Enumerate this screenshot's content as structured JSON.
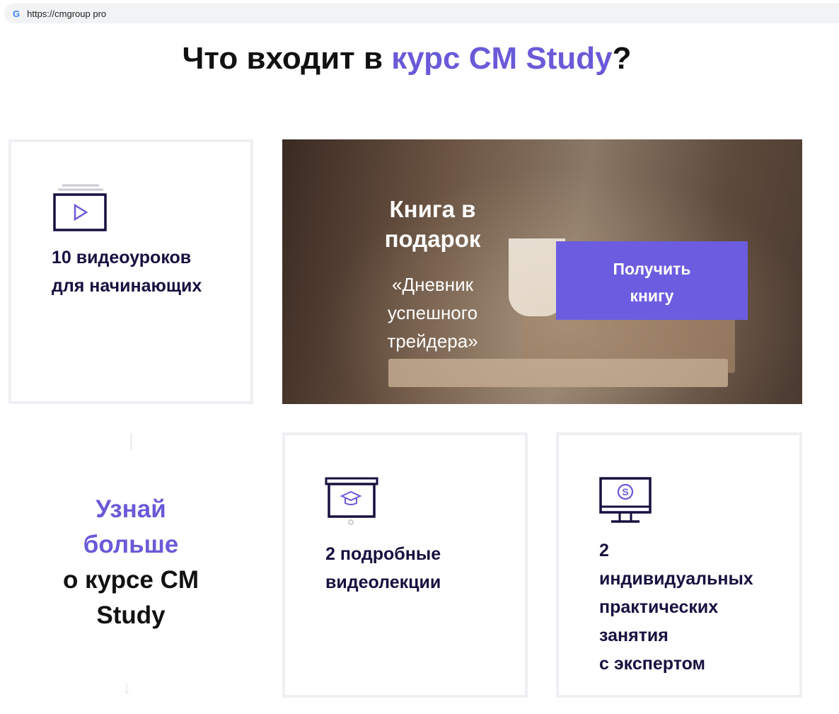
{
  "browser": {
    "url": "https://cmgroup pro"
  },
  "heading": {
    "prefix": "Что входит в ",
    "accent": "курс CM Study",
    "suffix": "?"
  },
  "cards": [
    {
      "icon": "video-play-icon",
      "text": "10 видеоуроков для начинающих"
    },
    {
      "icon": "presentation-graduation-icon",
      "text": "2 подробные видеолекции"
    },
    {
      "icon": "monitor-skype-icon",
      "lines": [
        "2",
        "индивидуальных",
        "практических",
        "занятия",
        "с экспертом"
      ]
    }
  ],
  "banner": {
    "title": "Книга в подарок",
    "subtitle": "«Дневник успешного трейдера»",
    "button": "Получить книгу"
  },
  "learn": {
    "line1": "Узнай",
    "line2": "больше",
    "line3": "о курсе CM Study"
  },
  "colors": {
    "accent": "#6a5ad8",
    "button": "#6c5ce0",
    "text": "#16113f"
  }
}
